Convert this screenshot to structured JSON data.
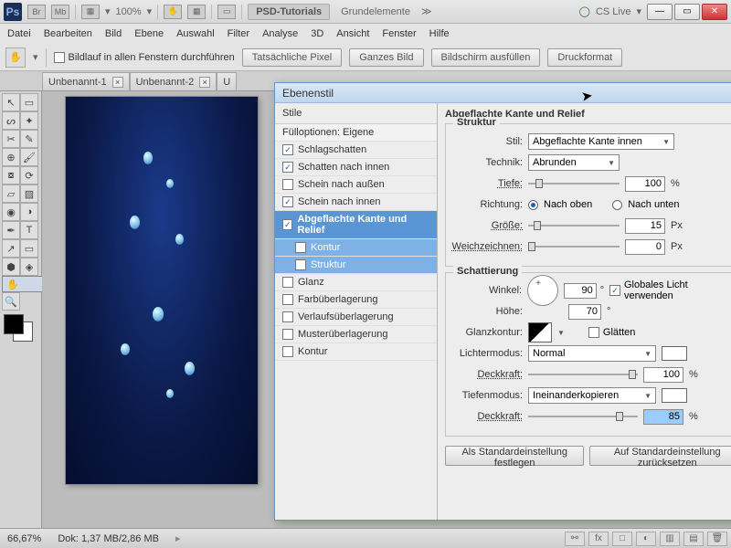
{
  "titlebar": {
    "zoom": "100%",
    "tab1": "PSD-Tutorials",
    "tab2": "Grundelemente",
    "cslive": "CS Live"
  },
  "menu": [
    "Datei",
    "Bearbeiten",
    "Bild",
    "Ebene",
    "Auswahl",
    "Filter",
    "Analyse",
    "3D",
    "Ansicht",
    "Fenster",
    "Hilfe"
  ],
  "optbar": {
    "scroll_label": "Bildlauf in allen Fenstern durchführen",
    "btn1": "Tatsächliche Pixel",
    "btn2": "Ganzes Bild",
    "btn3": "Bildschirm ausfüllen",
    "btn4": "Druckformat"
  },
  "doctabs": [
    {
      "label": "Unbenannt-1",
      "close": "×"
    },
    {
      "label": "Unbenannt-2",
      "close": "×"
    },
    {
      "label": "U",
      "close": ""
    }
  ],
  "dialog": {
    "title": "Ebenenstil",
    "styles_head": "Stile",
    "fill_opts": "Fülloptionen: Eigene",
    "items": {
      "schlag": "Schlagschatten",
      "innen_sch": "Schatten nach innen",
      "aussen_schein": "Schein nach außen",
      "innen_schein": "Schein nach innen",
      "bevel": "Abgeflachte Kante und Relief",
      "kontur_sub": "Kontur",
      "struktur_sub": "Struktur",
      "glanz": "Glanz",
      "farb": "Farbüberlagerung",
      "verlauf": "Verlaufsüberlagerung",
      "muster": "Musterüberlagerung",
      "kontur": "Kontur"
    },
    "panel_title": "Abgeflachte Kante und Relief",
    "struktur": {
      "group": "Struktur",
      "stil_lbl": "Stil:",
      "stil_val": "Abgeflachte Kante innen",
      "technik_lbl": "Technik:",
      "technik_val": "Abrunden",
      "tiefe_lbl": "Tiefe:",
      "tiefe_val": "100",
      "tiefe_unit": "%",
      "richtung_lbl": "Richtung:",
      "richtung_up": "Nach oben",
      "richtung_down": "Nach unten",
      "groesse_lbl": "Größe:",
      "groesse_val": "15",
      "px": "Px",
      "weich_lbl": "Weichzeichnen:",
      "weich_val": "0"
    },
    "schatt": {
      "group": "Schattierung",
      "winkel_lbl": "Winkel:",
      "winkel_val": "90",
      "deg": "°",
      "global": "Globales Licht verwenden",
      "hoehe_lbl": "Höhe:",
      "hoehe_val": "70",
      "gloss_lbl": "Glanzkontur:",
      "glaetten": "Glätten",
      "licht_lbl": "Lichtermodus:",
      "licht_val": "Normal",
      "deck_lbl": "Deckkraft:",
      "deck1_val": "100",
      "pct": "%",
      "tief_lbl": "Tiefenmodus:",
      "tief_val": "Ineinanderkopieren",
      "deck2_val": "85"
    },
    "btns": {
      "b1": "Als Standardeinstellung festlegen",
      "b2": "Auf Standardeinstellung zurücksetzen"
    }
  },
  "status": {
    "zoom": "66,67%",
    "doc": "Dok: 1,37 MB/2,86 MB"
  },
  "icons": {
    "br": "Br",
    "mb": "Mb",
    "frames": "▦",
    "drop": "▾",
    "arrows": "⇄",
    "more": "≫",
    "ring": "◯",
    "min": "—",
    "max": "▭",
    "close": "✕",
    "hand": "✋",
    "link": "⚯",
    "fx": "fx",
    "mask": "□",
    "fill": "◐",
    "folder": "▥",
    "new": "▤",
    "trash": "🗑"
  }
}
